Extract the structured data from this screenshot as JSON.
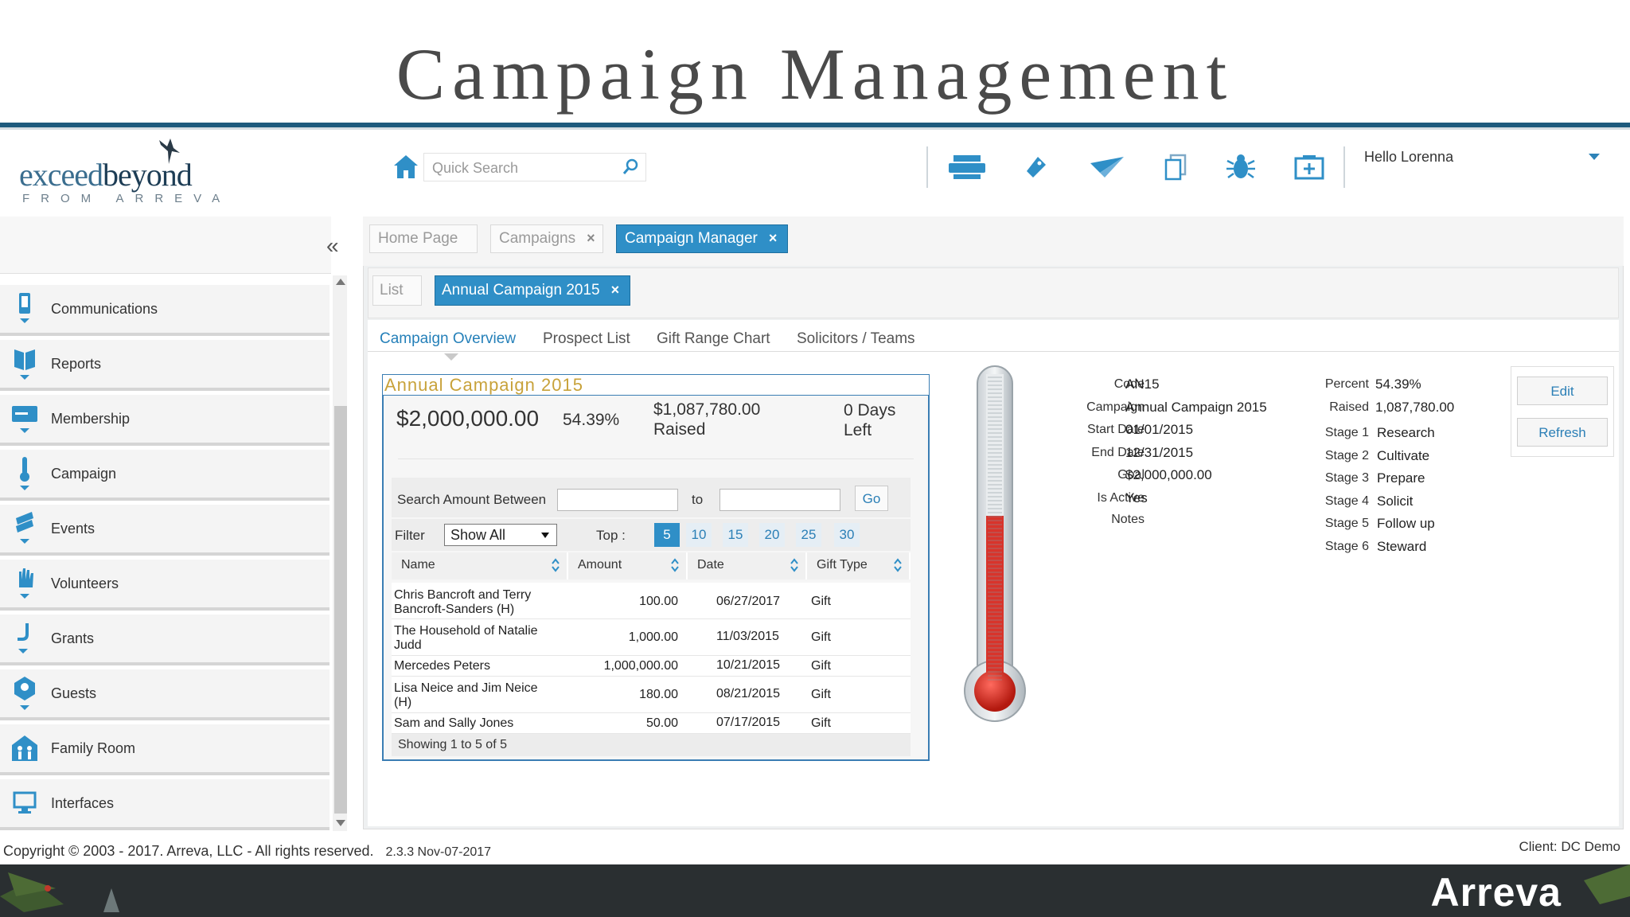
{
  "slide": {
    "title": "Campaign Management"
  },
  "logo": {
    "main_light": "exceed",
    "main_dark": "beyond",
    "sub": "FROM ARREVA"
  },
  "header": {
    "search_placeholder": "Quick Search",
    "greeting": "Hello Lorenna",
    "tool_icons": [
      "printer-icon",
      "tag-icon",
      "send-icon",
      "copy-icon",
      "bug-icon",
      "add-panel-icon"
    ]
  },
  "sidebar": {
    "items": [
      {
        "label": "Communications",
        "icon": "phone-icon"
      },
      {
        "label": "Reports",
        "icon": "book-icon"
      },
      {
        "label": "Membership",
        "icon": "card-icon"
      },
      {
        "label": "Campaign",
        "icon": "thermometer-icon"
      },
      {
        "label": "Events",
        "icon": "ticket-icon"
      },
      {
        "label": "Volunteers",
        "icon": "hand-icon"
      },
      {
        "label": "Grants",
        "icon": "grant-icon"
      },
      {
        "label": "Guests",
        "icon": "guest-icon"
      },
      {
        "label": "Family Room",
        "icon": "family-icon"
      },
      {
        "label": "Interfaces",
        "icon": "monitor-icon"
      }
    ]
  },
  "tabs": {
    "home": "Home Page",
    "campaigns": "Campaigns",
    "manager": "Campaign Manager",
    "close": "×"
  },
  "subtabs": {
    "list": "List",
    "campaign": "Annual Campaign 2015"
  },
  "views": [
    "Campaign Overview",
    "Prospect List",
    "Gift Range Chart",
    "Solicitors / Teams"
  ],
  "card": {
    "title": "Annual Campaign 2015",
    "goal": "$2,000,000.00",
    "percent": "54.39%",
    "raised_amount": "$1,087,780.00",
    "raised_label": "Raised",
    "days_value": "0 Days",
    "days_label": "Left",
    "search_label": "Search Amount Between",
    "to_label": "to",
    "go": "Go",
    "filter_label": "Filter",
    "filter_value": "Show All",
    "top_label": "Top :",
    "top_options": [
      "5",
      "10",
      "15",
      "20",
      "25",
      "30"
    ],
    "columns": [
      "Name",
      "Amount",
      "Date",
      "Gift Type"
    ],
    "rows": [
      {
        "name1": "Chris Bancroft and Terry",
        "name2": "Bancroft-Sanders (H)",
        "amount": "100.00",
        "date": "06/27/2017",
        "type": "Gift"
      },
      {
        "name1": "The Household of Natalie",
        "name2": "Judd",
        "amount": "1,000.00",
        "date": "11/03/2015",
        "type": "Gift"
      },
      {
        "name1": "Mercedes Peters",
        "name2": "",
        "amount": "1,000,000.00",
        "date": "10/21/2015",
        "type": "Gift"
      },
      {
        "name1": "Lisa Neice and Jim Neice",
        "name2": "(H)",
        "amount": "180.00",
        "date": "08/21/2015",
        "type": "Gift"
      },
      {
        "name1": "Sam and Sally Jones",
        "name2": "",
        "amount": "50.00",
        "date": "07/17/2015",
        "type": "Gift"
      }
    ],
    "footer": "Showing 1 to 5 of 5"
  },
  "thermometer": {
    "fill_fraction": 0.5439
  },
  "details": {
    "left": [
      {
        "label": "Code",
        "value": "AN15"
      },
      {
        "label": "Campaign",
        "value": "Annual Campaign 2015"
      },
      {
        "label": "Start Date",
        "value": "01/01/2015"
      },
      {
        "label": "End Date",
        "value": "12/31/2015"
      },
      {
        "label": "Goal",
        "value": "$2,000,000.00"
      },
      {
        "label": "Is Active",
        "value": "Yes"
      },
      {
        "label": "Notes",
        "value": ""
      }
    ],
    "right": [
      {
        "label": "Percent",
        "value": "54.39%"
      },
      {
        "label": "Raised",
        "value": "1,087,780.00"
      },
      {
        "label": "Stage 1",
        "value": "Research"
      },
      {
        "label": "Stage 2",
        "value": "Cultivate"
      },
      {
        "label": "Stage 3",
        "value": "Prepare"
      },
      {
        "label": "Stage 4",
        "value": "Solicit"
      },
      {
        "label": "Stage 5",
        "value": "Follow up"
      },
      {
        "label": "Stage 6",
        "value": "Steward"
      }
    ],
    "edit": "Edit",
    "refresh": "Refresh"
  },
  "footer": {
    "copyright": "Copyright © 2003 - 2017. Arreva, LLC - All rights reserved.",
    "version": "2.3.3 Nov-07-2017",
    "client": "Client: DC Demo",
    "brand": "Arreva"
  },
  "colors": {
    "accent": "#2f8fc7",
    "rule": "#1e5a7d",
    "gold": "#c8a23a",
    "mercury": "#d8342b"
  }
}
